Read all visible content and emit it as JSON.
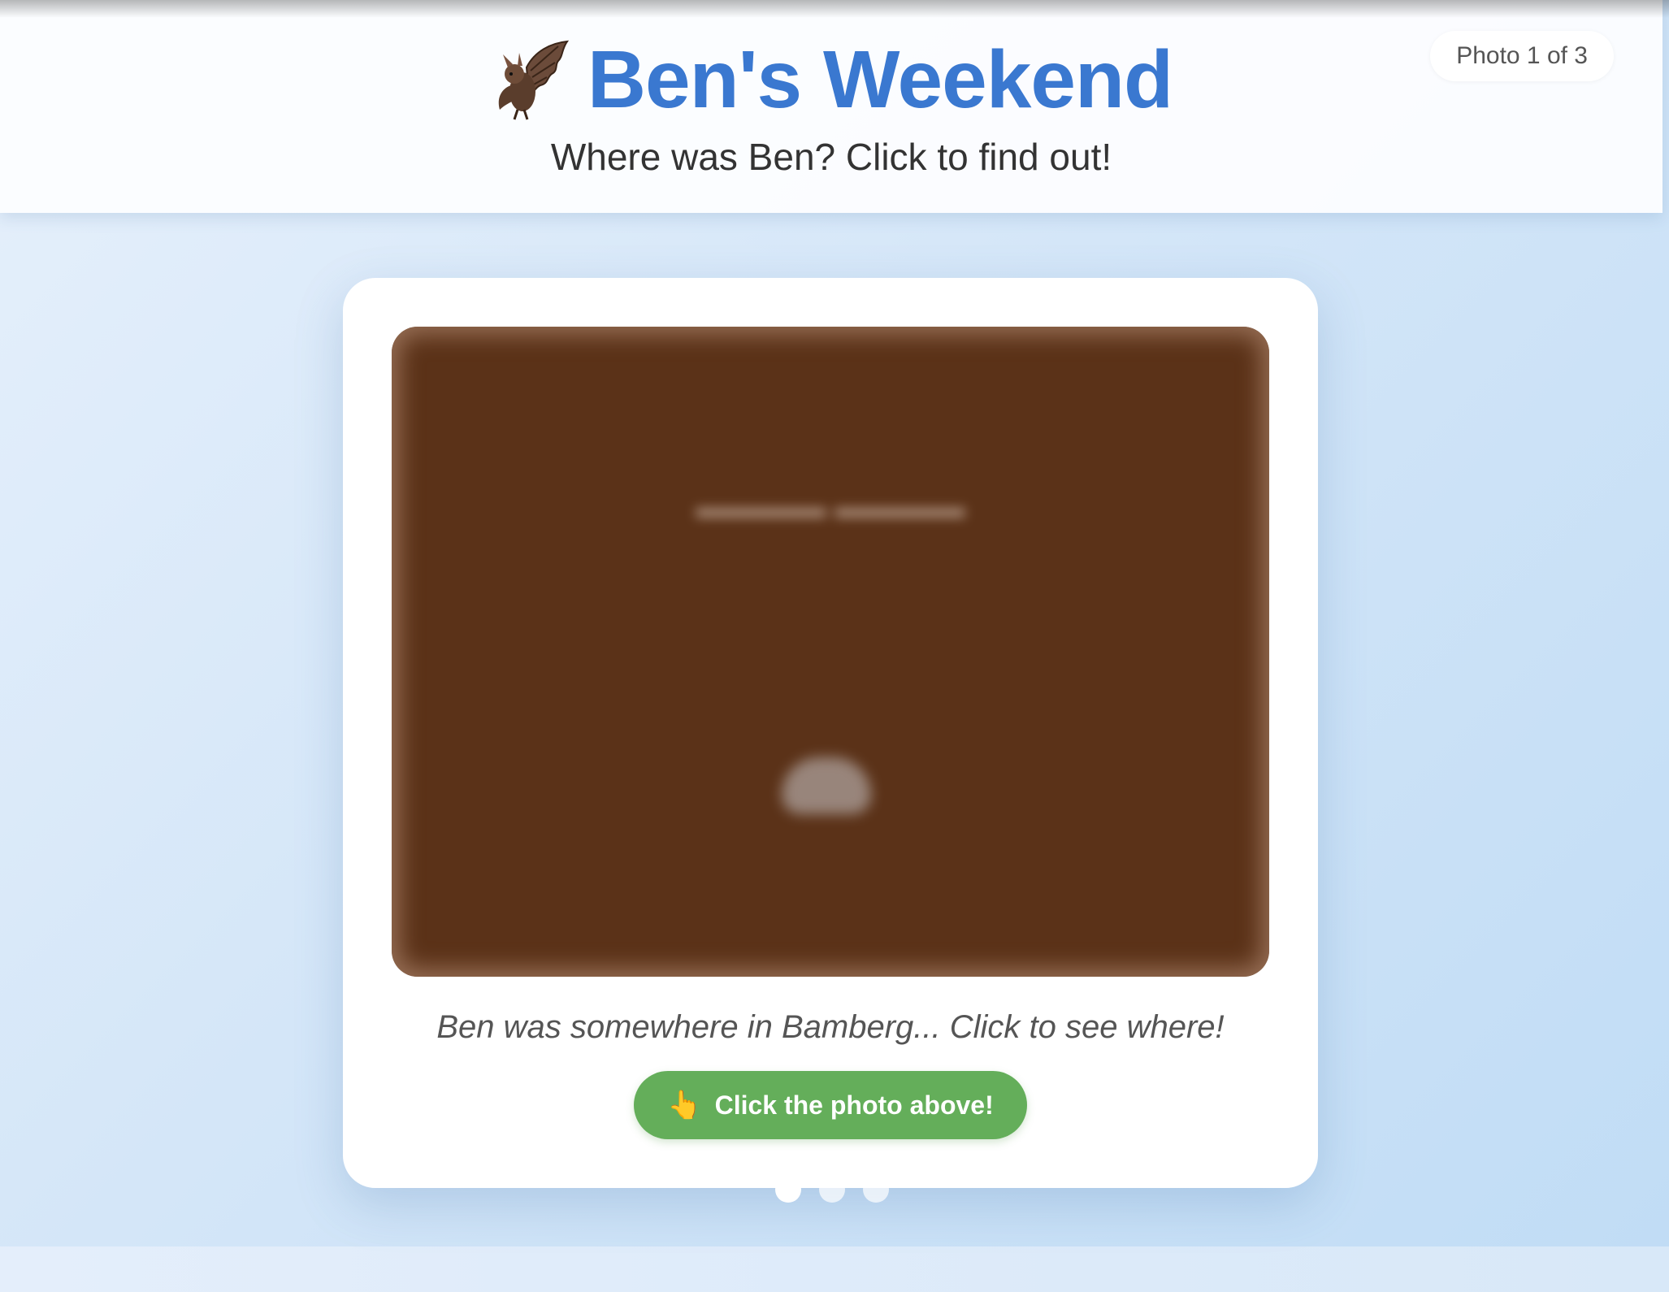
{
  "header": {
    "title": "Ben's Weekend",
    "subtitle": "Where was Ben? Click to find out!",
    "logo_icon": "bat-icon",
    "photo_counter": "Photo 1 of 3"
  },
  "main": {
    "caption": "Ben was somewhere in Bamberg... Click to see where!",
    "button_label": "Click the photo above!",
    "button_icon": "👆"
  },
  "carousel": {
    "total": 3,
    "active_index": 0
  },
  "colors": {
    "title": "#3a78d0",
    "button": "#64ae5a",
    "photo_blurred": "#5b3218",
    "background": "#d4e6f8"
  }
}
